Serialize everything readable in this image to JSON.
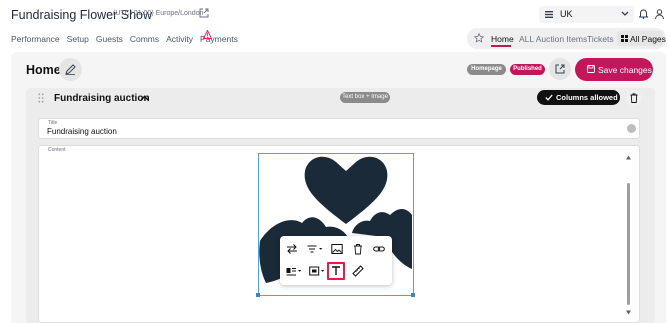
{
  "app": {
    "title": "Fundraising Flower Show",
    "timezone": "(UTC+01:00) Europe/London",
    "region": "UK"
  },
  "nav": [
    "Performance",
    "Setup",
    "Guests",
    "Comms",
    "Activity",
    "Payments"
  ],
  "right_nav": {
    "home": "Home",
    "auction": "ALL Auction Items",
    "tickets": "Tickets",
    "all_pages": "All Pages"
  },
  "page": {
    "heading": "Home",
    "badge_homepage": "Homepage",
    "badge_published": "Published",
    "save_label": "Save changes"
  },
  "section": {
    "title": "Fundraising auction",
    "type": "Text box + Image",
    "columns_label": "Columns allowed",
    "title_field_label": "Title",
    "title_field_value": "Fundraising auction",
    "content_field_label": "Content"
  },
  "colors": {
    "accent": "#c2185b",
    "selection": "#2f86d6",
    "image": "#1b2a38"
  },
  "icons": {
    "toolbar_row1": [
      "swap-icon",
      "align-icon",
      "replace-image-icon",
      "delete-icon",
      "link-icon"
    ],
    "toolbar_row2": [
      "inline-layout-icon",
      "image-size-icon",
      "alt-text-icon",
      "style-icon"
    ]
  }
}
